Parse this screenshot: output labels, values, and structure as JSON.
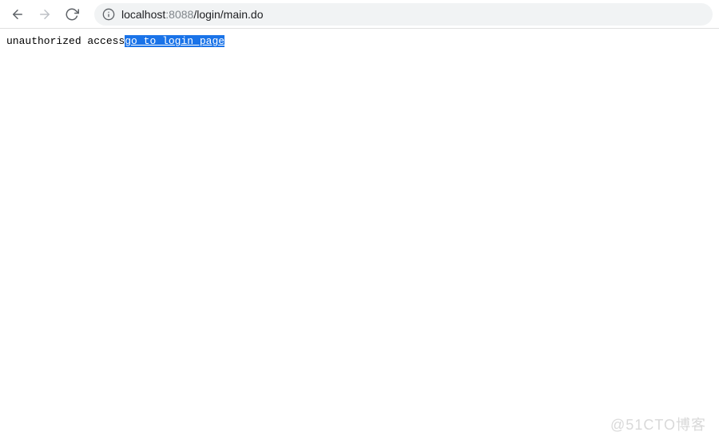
{
  "toolbar": {
    "url_host": "localhost",
    "url_port": ":8088",
    "url_path": "/login/main.do"
  },
  "page": {
    "message": "unauthorized access",
    "link_text": "go to login page"
  },
  "watermark": "@51CTO博客"
}
